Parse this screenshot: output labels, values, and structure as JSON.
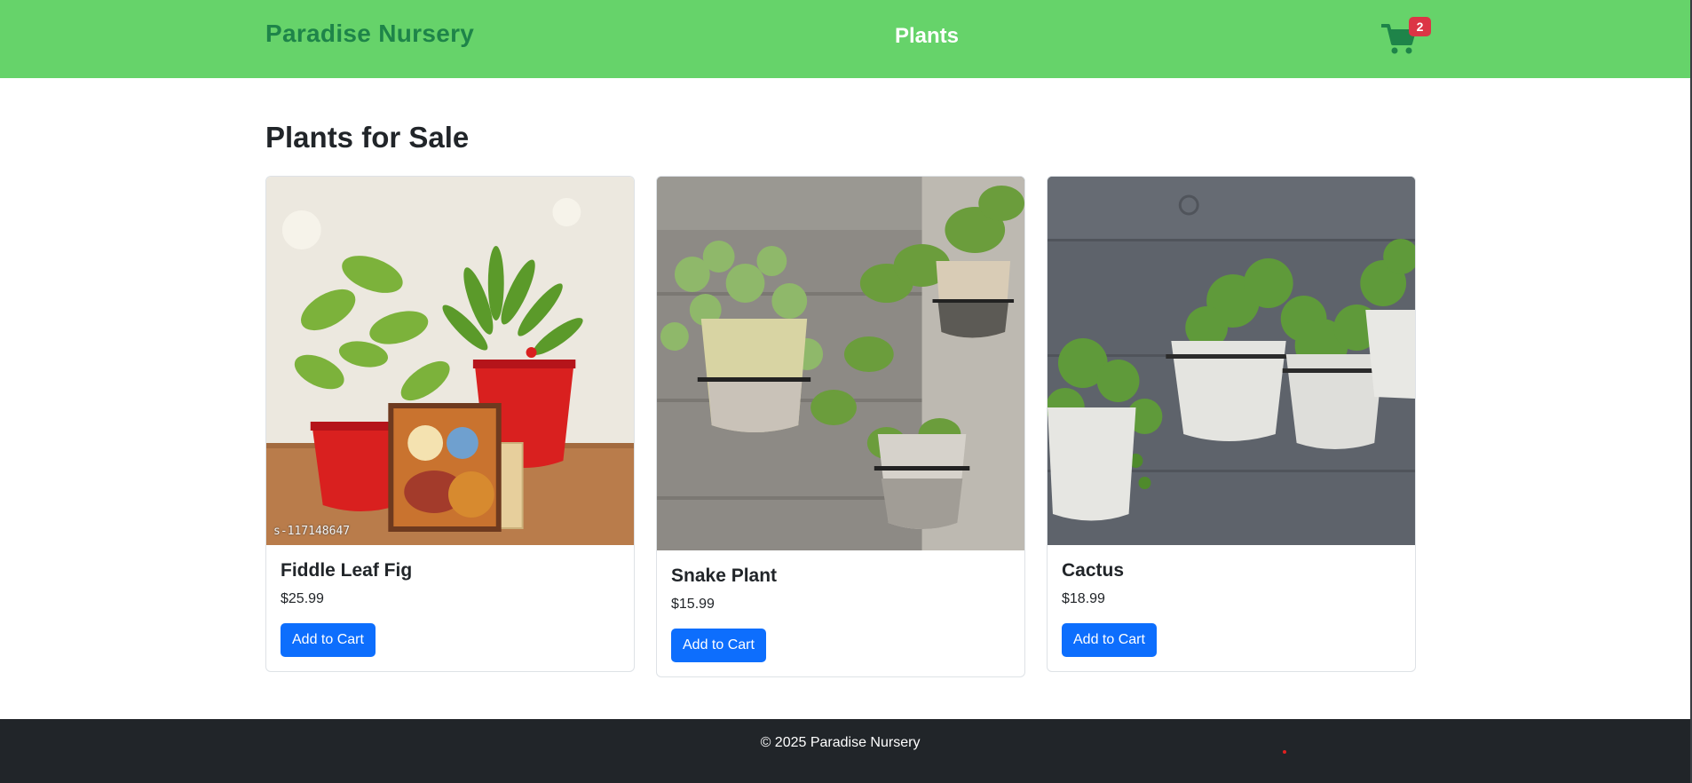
{
  "header": {
    "brand": "Paradise Nursery",
    "title": "Plants",
    "cart_icon": "shopping-cart-icon",
    "cart_count": "2"
  },
  "main": {
    "heading": "Plants for Sale",
    "products": [
      {
        "name": "Fiddle Leaf Fig",
        "price": "$25.99",
        "button_label": "Add to Cart",
        "image_watermark": "s-117148647"
      },
      {
        "name": "Snake Plant",
        "price": "$15.99",
        "button_label": "Add to Cart"
      },
      {
        "name": "Cactus",
        "price": "$18.99",
        "button_label": "Add to Cart"
      }
    ]
  },
  "footer": {
    "text": "© 2025 Paradise Nursery"
  },
  "colors": {
    "header_bg": "#66d36a",
    "brand": "#1e8449",
    "cart_icon": "#1e8449",
    "badge": "#dc3545",
    "button": "#0d6efd",
    "footer_bg": "#212529"
  }
}
